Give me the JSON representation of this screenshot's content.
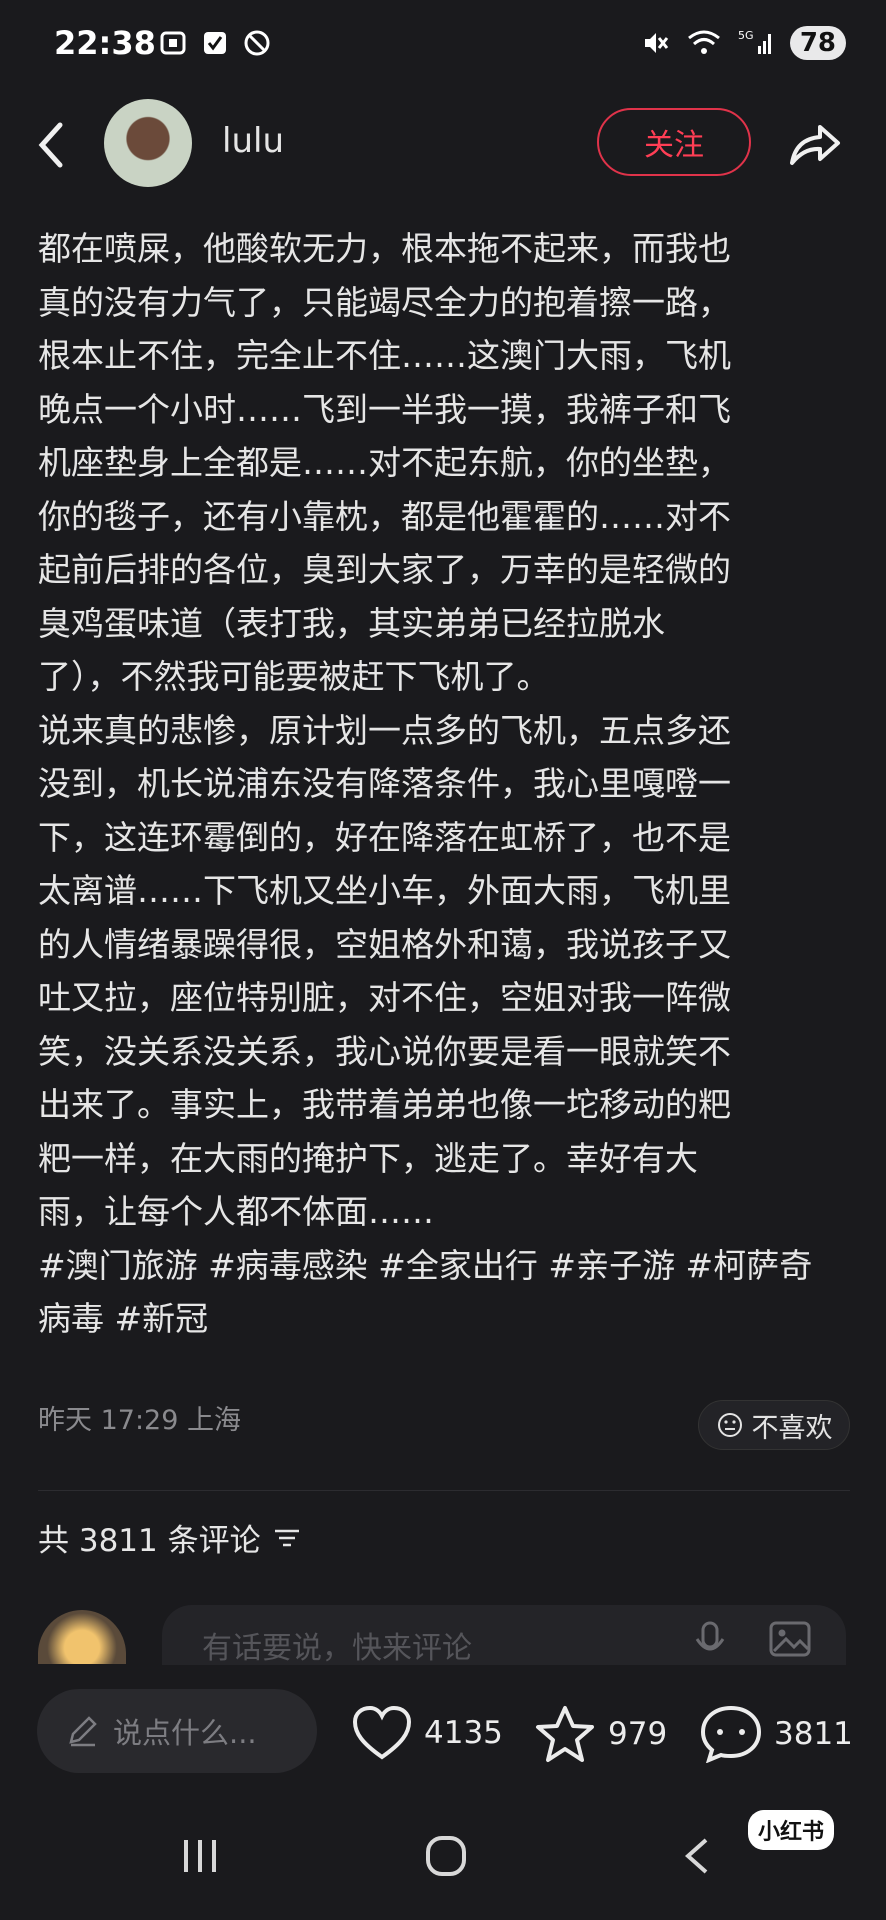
{
  "status_bar": {
    "time": "22:38",
    "battery": "78",
    "signal_label": "5G"
  },
  "header": {
    "username": "lulu",
    "follow_label": "关注"
  },
  "post": {
    "lines": [
      "都在喷屎，他酸软无力，根本拖不起来，而我也",
      "真的没有力气了，只能竭尽全力的抱着擦一路，",
      "根本止不住，完全止不住……这澳门大雨，飞机",
      "晚点一个小时……飞到一半我一摸，我裤子和飞",
      "机座垫身上全都是……对不起东航，你的坐垫，",
      "你的毯子，还有小靠枕，都是他霍霍的……对不",
      "起前后排的各位，臭到大家了，万幸的是轻微的",
      "臭鸡蛋味道（表打我，其实弟弟已经拉脱水",
      "了），不然我可能要被赶下飞机了。",
      "说来真的悲惨，原计划一点多的飞机，五点多还",
      "没到，机长说浦东没有降落条件，我心里嘎噔一",
      "下，这连环霉倒的，好在降落在虹桥了，也不是",
      "太离谱……下飞机又坐小车，外面大雨，飞机里",
      "的人情绪暴躁得很，空姐格外和蔼，我说孩子又",
      "吐又拉，座位特别脏，对不住，空姐对我一阵微",
      "笑，没关系没关系，我心说你要是看一眼就笑不",
      "出来了。事实上，我带着弟弟也像一坨移动的粑",
      "粑一样，在大雨的掩护下，逃走了。幸好有大",
      "雨，让每个人都不体面……"
    ],
    "hashtag_lines": [
      "#澳门旅游 #病毒感染 #全家出行 #亲子游 #柯萨奇",
      "病毒 #新冠"
    ],
    "meta": "昨天 17:29 上海",
    "dislike_label": "不喜欢"
  },
  "comments": {
    "title": "共 3811 条评论",
    "placeholder": "有话要说，快来评论"
  },
  "bottom_bar": {
    "say_placeholder": "说点什么...",
    "likes": "4135",
    "favorites": "979",
    "comments": "3811"
  },
  "watermark": "小红书"
}
